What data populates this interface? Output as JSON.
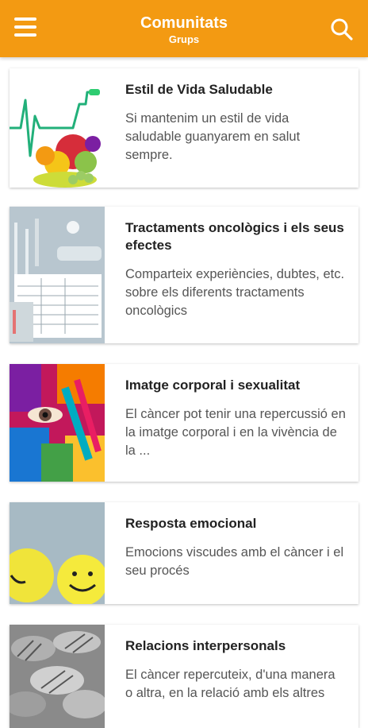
{
  "header": {
    "title": "Comunitats",
    "subtitle": "Grups",
    "background_color": "#f39a12",
    "menu_icon": "hamburger-menu-icon",
    "search_icon": "search-icon"
  },
  "groups": [
    {
      "title": "Estil de Vida Saludable",
      "description": "Si mantenim un estil de vida saludable guanyarem en salut sempre."
    },
    {
      "title": "Tractaments oncològics i els seus efectes",
      "description": "Comparteix experiències, dubtes, etc. sobre els diferents tractaments oncològics"
    },
    {
      "title": "Imatge corporal i sexualitat",
      "description": "El càncer pot tenir una repercussió en la imatge corporal i en la vivència de la ..."
    },
    {
      "title": "Resposta emocional",
      "description": "Emocions viscudes amb el càncer i el seu procés"
    },
    {
      "title": "Relacions interpersonals",
      "description": "El càncer repercuteix, d'una manera o altra, en la relació amb els altres"
    }
  ]
}
